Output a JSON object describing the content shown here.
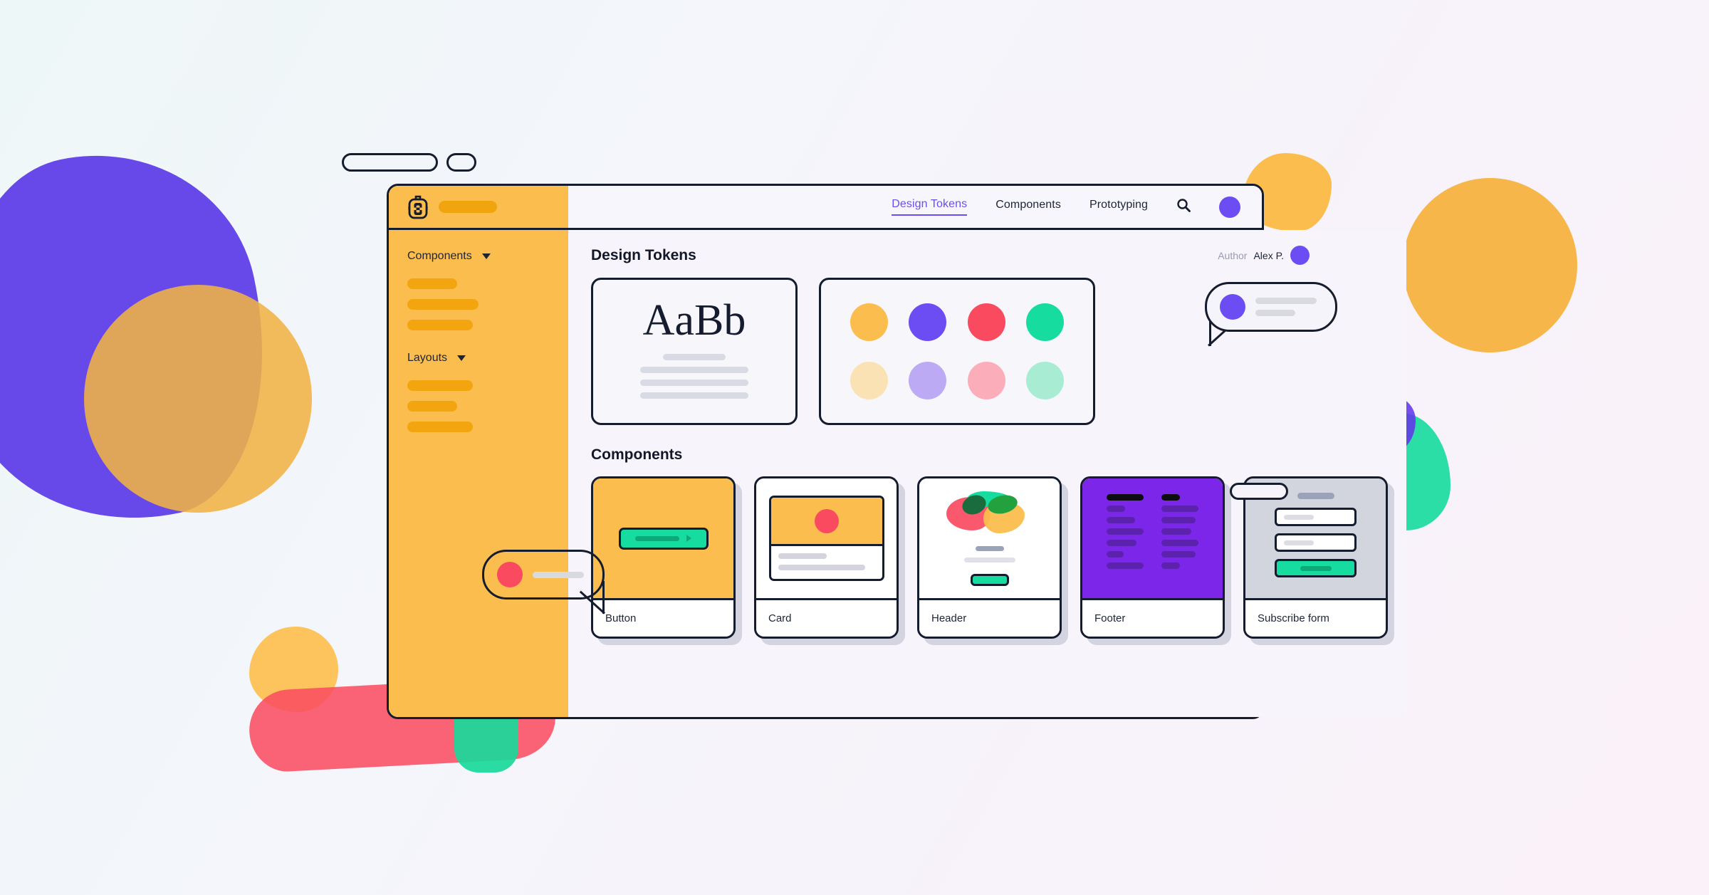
{
  "window_chrome": {
    "pill_wide": "",
    "pill_small": "",
    "resize_handle": ""
  },
  "topbar": {
    "logo_icon": "backpack-icon",
    "brand_name_placeholder": "",
    "nav_links": [
      {
        "label": "Design Tokens",
        "active": true
      },
      {
        "label": "Components",
        "active": false
      },
      {
        "label": "Prototyping",
        "active": false
      }
    ],
    "search_icon": "search-icon",
    "avatar_color": "#6c4df3"
  },
  "sidebar": {
    "background": "#fbbe4e",
    "groups": [
      {
        "title": "Components",
        "caret": "chevron-down-icon",
        "item_widths": [
          "70px",
          "100px",
          "92px"
        ]
      },
      {
        "title": "Layouts",
        "caret": "chevron-down-icon",
        "item_widths": [
          "92px",
          "70px",
          "92px"
        ]
      }
    ]
  },
  "main": {
    "design_tokens": {
      "title": "Design Tokens",
      "author_label": "Author",
      "author_name": "Alex P.",
      "author_avatar_color": "#6c4df3",
      "typography_card": {
        "sample_text": "AaBb",
        "line_widths": [
          "88px",
          "152px",
          "152px",
          "152px"
        ]
      },
      "palette_card": {
        "swatches": [
          {
            "name": "amber",
            "hex": "#fbbe4e"
          },
          {
            "name": "purple",
            "hex": "#6c4df3"
          },
          {
            "name": "red",
            "hex": "#fa4a5f"
          },
          {
            "name": "green",
            "hex": "#16dc9f"
          },
          {
            "name": "amber-light",
            "hex": "#fbe2b4"
          },
          {
            "name": "purple-light",
            "hex": "#bcabf4"
          },
          {
            "name": "red-light",
            "hex": "#fbadb9"
          },
          {
            "name": "green-light",
            "hex": "#a8ecd4"
          }
        ]
      }
    },
    "components": {
      "title": "Components",
      "cards": [
        {
          "name": "button",
          "label": "Button"
        },
        {
          "name": "card",
          "label": "Card"
        },
        {
          "name": "header",
          "label": "Header"
        },
        {
          "name": "footer",
          "label": "Footer"
        },
        {
          "name": "subscribe-form",
          "label": "Subscribe form"
        }
      ],
      "footer_columns": [
        {
          "bar_widths": [
            "52px",
            "26px",
            "40px",
            "52px",
            "42px",
            "24px",
            "52px"
          ]
        },
        {
          "bar_widths": [
            "26px",
            "52px",
            "48px",
            "42px",
            "52px",
            "48px",
            "26px"
          ]
        }
      ]
    }
  },
  "bubbles": [
    {
      "name": "comment-bubble-right",
      "avatar_color": "#6c4df3",
      "line_widths": [
        "86px",
        "56px"
      ]
    },
    {
      "name": "comment-bubble-left",
      "avatar_color": "#fa4a5f",
      "line_widths": [
        "72px"
      ]
    }
  ],
  "decoration": {
    "blobs": [
      {
        "name": "blob-purple-left",
        "hex": "#5b3ae8"
      },
      {
        "name": "blob-amber-left",
        "hex": "#f0b344"
      },
      {
        "name": "blob-amber-right-big",
        "hex": "#f5b23f"
      },
      {
        "name": "blob-amber-topnotch",
        "hex": "#fbbe4e"
      },
      {
        "name": "blob-amber-bottom-left",
        "hex": "#fdc052"
      },
      {
        "name": "blob-red-bottom",
        "hex": "#fa4a5f"
      },
      {
        "name": "blob-green-bottom",
        "hex": "#18d99a"
      },
      {
        "name": "blob-green-right",
        "hex": "#1fdca0"
      },
      {
        "name": "blob-purple-right",
        "hex": "#6337ea"
      }
    ]
  }
}
